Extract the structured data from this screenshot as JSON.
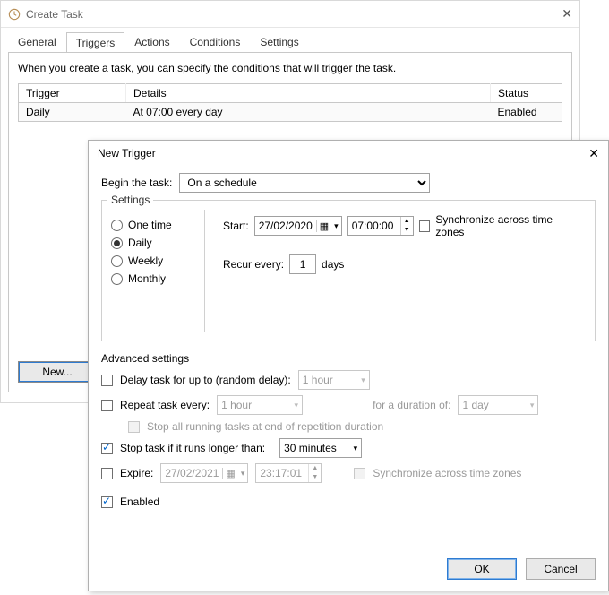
{
  "backWindow": {
    "title": "Create Task",
    "tabs": [
      "General",
      "Triggers",
      "Actions",
      "Conditions",
      "Settings"
    ],
    "activeTab": "Triggers",
    "desc": "When you create a task, you can specify the conditions that will trigger the task.",
    "tableHeaders": {
      "trigger": "Trigger",
      "details": "Details",
      "status": "Status"
    },
    "tableRow": {
      "trigger": "Daily",
      "details": "At 07:00 every day",
      "status": "Enabled"
    },
    "newBtn": "New..."
  },
  "frontWindow": {
    "title": "New Trigger",
    "beginLabel": "Begin the task:",
    "beginValue": "On a schedule",
    "settingsLegend": "Settings",
    "recurrence": {
      "oneTime": "One time",
      "daily": "Daily",
      "weekly": "Weekly",
      "monthly": "Monthly"
    },
    "startLabel": "Start:",
    "startDate": "27/02/2020",
    "startTime": "07:00:00",
    "syncLabel": "Synchronize across time zones",
    "recurEveryLabel": "Recur every:",
    "recurEveryValue": "1",
    "daysLabel": "days",
    "advanced": {
      "title": "Advanced settings",
      "delayLabel": "Delay task for up to (random delay):",
      "delayValue": "1 hour",
      "repeatLabel": "Repeat task every:",
      "repeatValue": "1 hour",
      "durationLabel": "for a duration of:",
      "durationValue": "1 day",
      "stopAllLabel": "Stop all running tasks at end of repetition duration",
      "stopIfLabel": "Stop task if it runs longer than:",
      "stopIfValue": "30 minutes",
      "expireLabel": "Expire:",
      "expireDate": "27/02/2021",
      "expireTime": "23:17:01",
      "sync2Label": "Synchronize across time zones",
      "enabledLabel": "Enabled"
    },
    "buttons": {
      "ok": "OK",
      "cancel": "Cancel"
    }
  }
}
